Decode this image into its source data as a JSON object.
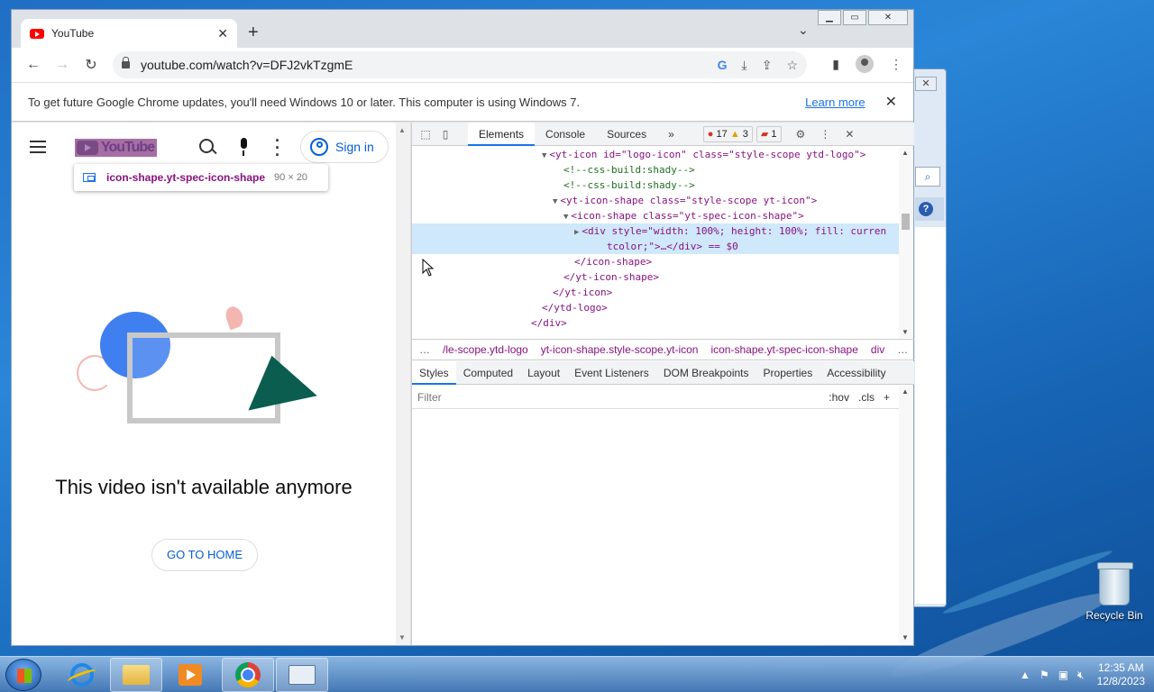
{
  "desktop": {
    "recycle_bin_label": "Recycle Bin"
  },
  "browser": {
    "tab_title": "YouTube",
    "url": "youtube.com/watch?v=DFJ2vkTzgmE",
    "infobar": {
      "message": "To get future Google Chrome updates, you'll need Windows 10 or later. This computer is using Windows 7.",
      "link": "Learn more"
    }
  },
  "youtube": {
    "logo_text": "YouTube",
    "signin_label": "Sign in",
    "tooltip": {
      "name": "icon-shape.yt-spec-icon-shape",
      "size": "90 × 20"
    },
    "message": "This video isn't available anymore",
    "go_home": "GO TO HOME"
  },
  "devtools": {
    "tabs": [
      "Elements",
      "Console",
      "Sources"
    ],
    "error_count": "17",
    "warning_count": "3",
    "issue_count": "1",
    "dom_lines": [
      {
        "indent": 12,
        "arrow": "▼",
        "html": "<yt-icon id=\"logo-icon\" class=\"style-scope ytd-logo\">"
      },
      {
        "indent": 14,
        "arrow": "",
        "html": "<!--css-build:shady-->"
      },
      {
        "indent": 14,
        "arrow": "",
        "html": "<!--css-build:shady-->"
      },
      {
        "indent": 13,
        "arrow": "▼",
        "html": "<yt-icon-shape class=\"style-scope yt-icon\">"
      },
      {
        "indent": 14,
        "arrow": "▼",
        "html": "<icon-shape class=\"yt-spec-icon-shape\">"
      },
      {
        "indent": 15,
        "arrow": "▶",
        "html": "<div style=\"width: 100%; height: 100%; fill: curren",
        "selected": true
      },
      {
        "indent": 18,
        "arrow": "",
        "html": "tcolor;\">…</div> == $0",
        "selected": true
      },
      {
        "indent": 15,
        "arrow": "",
        "html": "</icon-shape>"
      },
      {
        "indent": 14,
        "arrow": "",
        "html": "</yt-icon-shape>"
      },
      {
        "indent": 13,
        "arrow": "",
        "html": "</yt-icon>"
      },
      {
        "indent": 12,
        "arrow": "",
        "html": "</ytd-logo>"
      },
      {
        "indent": 11,
        "arrow": "",
        "html": "</div>"
      }
    ],
    "breadcrumbs": [
      "…",
      "/le-scope.ytd-logo",
      "yt-icon-shape.style-scope.yt-icon",
      "icon-shape.yt-spec-icon-shape",
      "div",
      "…"
    ],
    "styles_tabs": [
      "Styles",
      "Computed",
      "Layout",
      "Event Listeners",
      "DOM Breakpoints",
      "Properties",
      "Accessibility"
    ],
    "filter_placeholder": "Filter",
    "hov": ":hov",
    "cls": ".cls"
  },
  "taskbar": {
    "time": "12:35 AM",
    "date": "12/8/2023"
  }
}
